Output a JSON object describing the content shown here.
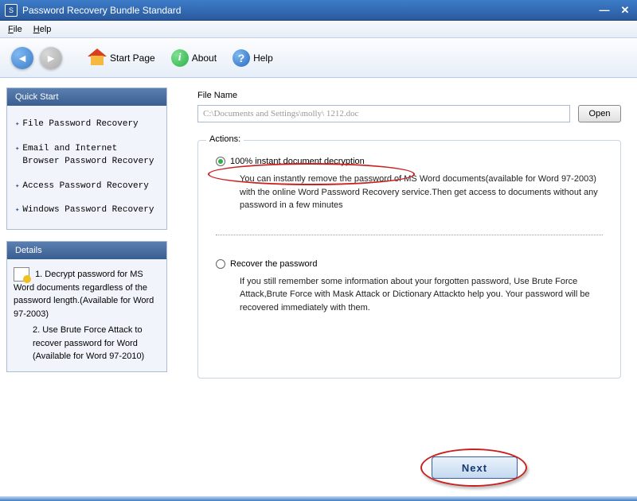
{
  "window": {
    "title": "Password Recovery Bundle Standard"
  },
  "menu": {
    "file": "File",
    "help": "Help"
  },
  "toolbar": {
    "start_page": "Start Page",
    "about": "About",
    "help": "Help"
  },
  "sidebar": {
    "quickstart": {
      "title": "Quick Start",
      "items": [
        "File Password Recovery",
        "Email and Internet Browser Password Recovery",
        "Access Password Recovery",
        "Windows Password Recovery"
      ]
    },
    "details": {
      "title": "Details",
      "text1": "1. Decrypt password for MS Word documents regardless of the password length.(Available for Word 97-2003)",
      "text2": "2. Use Brute Force Attack to recover password for Word (Available for Word 97-2010)"
    }
  },
  "main": {
    "filename_label": "File Name",
    "filename_value": "C:\\Documents and Settings\\molly\\ 1212.doc",
    "open_label": "Open",
    "actions_label": "Actions:",
    "option1": {
      "label": "100% instant document decryption",
      "desc": "You can instantly remove the password of MS Word documents(available for Word 97-2003) with the online Word Password Recovery service.Then get access to documents without any password in a few minutes"
    },
    "option2": {
      "label": "Recover the password",
      "desc": "If you still remember some information about your forgotten password, Use Brute Force Attack,Brute Force with Mask Attack or Dictionary Attackto help you. Your password will be recovered immediately with them."
    },
    "next_label": "Next"
  }
}
